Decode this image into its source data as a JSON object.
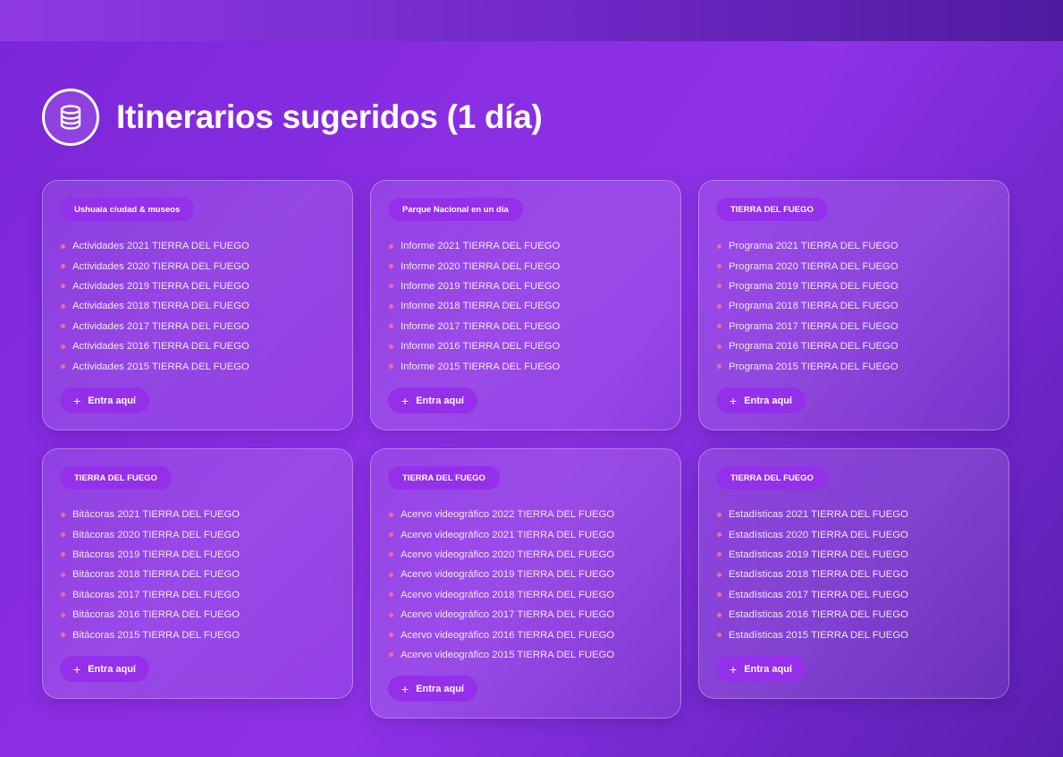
{
  "header": {
    "title": "Itinerarios sugeridos (1 día)",
    "icon": "database-icon"
  },
  "colors": {
    "accent": "#9430ea",
    "bullet": "#f06aa8",
    "background": "#8a2ee3"
  },
  "cards": [
    {
      "chip": "Ushuaia ciudad & museos",
      "items": [
        "Actividades 2021 TIERRA DEL FUEGO",
        "Actividades 2020 TIERRA DEL FUEGO",
        "Actividades 2019 TIERRA DEL FUEGO",
        "Actividades 2018 TIERRA DEL FUEGO",
        "Actividades 2017 TIERRA DEL FUEGO",
        "Actividades 2016 TIERRA DEL FUEGO",
        "Actividades 2015 TIERRA DEL FUEGO"
      ],
      "button": "Entra aquí"
    },
    {
      "chip": "Parque Nacional en un día",
      "items": [
        "Informe 2021 TIERRA DEL FUEGO",
        "Informe 2020 TIERRA DEL FUEGO",
        "Informe 2019 TIERRA DEL FUEGO",
        "Informe 2018 TIERRA DEL FUEGO",
        "Informe 2017 TIERRA DEL FUEGO",
        "Informe 2016 TIERRA DEL FUEGO",
        "Informe 2015 TIERRA DEL FUEGO"
      ],
      "button": "Entra aquí"
    },
    {
      "chip": "TIERRA DEL FUEGO",
      "items": [
        "Programa 2021 TIERRA DEL FUEGO",
        "Programa 2020 TIERRA DEL FUEGO",
        "Programa 2019 TIERRA DEL FUEGO",
        "Programa 2018 TIERRA DEL FUEGO",
        "Programa 2017 TIERRA DEL FUEGO",
        "Programa 2016 TIERRA DEL FUEGO",
        "Programa 2015 TIERRA DEL FUEGO"
      ],
      "button": "Entra aquí"
    },
    {
      "chip": "TIERRA DEL FUEGO",
      "items": [
        "Bitácoras 2021 TIERRA DEL FUEGO",
        "Bitácoras 2020 TIERRA DEL FUEGO",
        "Bitácoras 2019 TIERRA DEL FUEGO",
        "Bitácoras 2018 TIERRA DEL FUEGO",
        "Bitácoras 2017 TIERRA DEL FUEGO",
        "Bitácoras 2016 TIERRA DEL FUEGO",
        "Bitácoras 2015 TIERRA DEL FUEGO"
      ],
      "button": "Entra aquí"
    },
    {
      "chip": "TIERRA DEL FUEGO",
      "items": [
        "Acervo videográfico 2022 TIERRA DEL FUEGO",
        "Acervo videográfico 2021 TIERRA DEL FUEGO",
        "Acervo videográfico 2020 TIERRA DEL FUEGO",
        "Acervo videográfico 2019 TIERRA DEL FUEGO",
        "Acervo videográfico 2018 TIERRA DEL FUEGO",
        "Acervo videográfico 2017 TIERRA DEL FUEGO",
        "Acervo videográfico 2016 TIERRA DEL FUEGO",
        "Acervo videográfico 2015 TIERRA DEL FUEGO"
      ],
      "button": "Entra aquí"
    },
    {
      "chip": "TIERRA DEL FUEGO",
      "items": [
        "Estadísticas 2021 TIERRA DEL FUEGO",
        "Estadísticas 2020 TIERRA DEL FUEGO",
        "Estadísticas 2019 TIERRA DEL FUEGO",
        "Estadísticas 2018 TIERRA DEL FUEGO",
        "Estadísticas 2017 TIERRA DEL FUEGO",
        "Estadísticas 2016 TIERRA DEL FUEGO",
        "Estadísticas 2015 TIERRA DEL FUEGO"
      ],
      "button": "Entra aquí"
    }
  ]
}
